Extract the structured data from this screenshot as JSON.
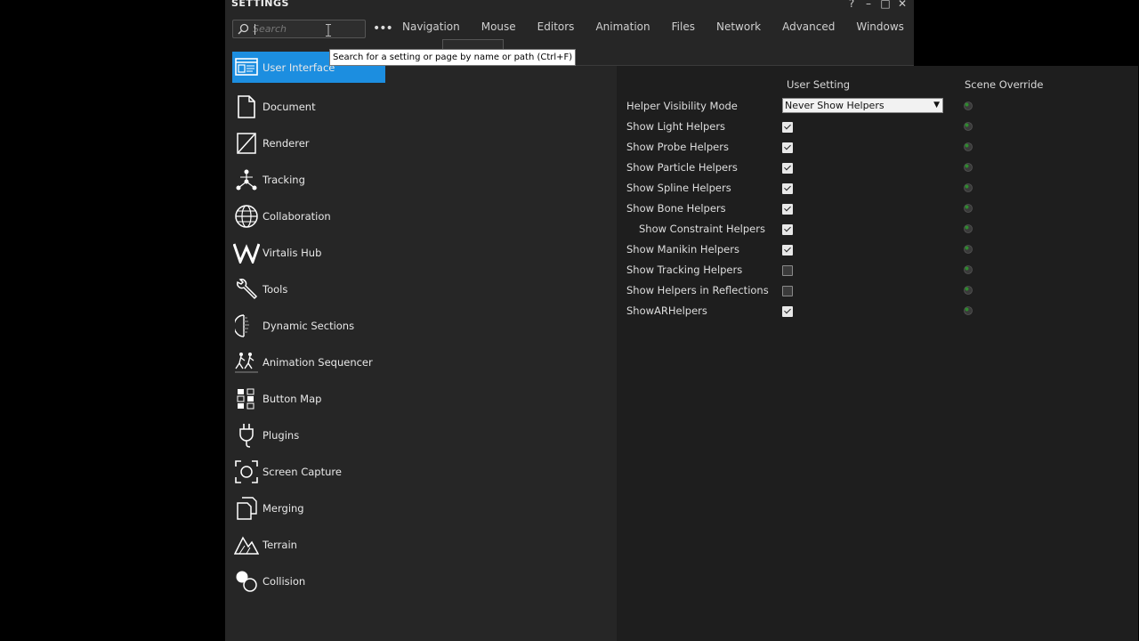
{
  "window": {
    "title": "SETTINGS",
    "controls": {
      "help": "?",
      "minimize": "–",
      "maximize": "□",
      "close": "✕"
    }
  },
  "search": {
    "placeholder": "Search",
    "value": ""
  },
  "more_button": "•••",
  "tabs": [
    {
      "label": "Navigation"
    },
    {
      "label": "Mouse"
    },
    {
      "label": "Editors"
    },
    {
      "label": "Animation"
    },
    {
      "label": "Files"
    },
    {
      "label": "Network"
    },
    {
      "label": "Advanced"
    },
    {
      "label": "Windows"
    }
  ],
  "tooltip": "Search for a setting or page by name or path (Ctrl+F)",
  "sidebar": {
    "items": [
      {
        "label": "User Interface",
        "icon": "user-interface-icon",
        "active": true
      },
      {
        "label": "Document",
        "icon": "document-icon"
      },
      {
        "label": "Renderer",
        "icon": "renderer-icon"
      },
      {
        "label": "Tracking",
        "icon": "tracking-icon"
      },
      {
        "label": "Collaboration",
        "icon": "globe-icon"
      },
      {
        "label": "Virtalis Hub",
        "icon": "virtalis-logo-icon"
      },
      {
        "label": "Tools",
        "icon": "wrench-icon"
      },
      {
        "label": "Dynamic Sections",
        "icon": "dynamic-sections-icon"
      },
      {
        "label": "Animation Sequencer",
        "icon": "animation-sequencer-icon"
      },
      {
        "label": "Button Map",
        "icon": "button-map-icon"
      },
      {
        "label": "Plugins",
        "icon": "plug-icon"
      },
      {
        "label": "Screen Capture",
        "icon": "screen-capture-icon"
      },
      {
        "label": "Merging",
        "icon": "merging-icon"
      },
      {
        "label": "Terrain",
        "icon": "terrain-icon"
      },
      {
        "label": "Collision",
        "icon": "collision-icon"
      }
    ]
  },
  "main": {
    "columns": {
      "user_setting": "User Setting",
      "scene_override": "Scene Override"
    },
    "helper_visibility": {
      "label": "Helper Visibility Mode",
      "value": "Never Show Helpers"
    },
    "rows": [
      {
        "label": "Show Light Helpers",
        "checked": true,
        "indent": false
      },
      {
        "label": "Show Probe Helpers",
        "checked": true,
        "indent": false
      },
      {
        "label": "Show Particle Helpers",
        "checked": true,
        "indent": false
      },
      {
        "label": "Show Spline Helpers",
        "checked": true,
        "indent": false
      },
      {
        "label": "Show Bone Helpers",
        "checked": true,
        "indent": false
      },
      {
        "label": "Show Constraint Helpers",
        "checked": true,
        "indent": true
      },
      {
        "label": "Show Manikin Helpers",
        "checked": true,
        "indent": false
      },
      {
        "label": "Show Tracking Helpers",
        "checked": false,
        "indent": false
      },
      {
        "label": "Show Helpers in Reflections",
        "checked": false,
        "indent": false
      },
      {
        "label": "ShowARHelpers",
        "checked": true,
        "indent": false
      }
    ]
  },
  "colors": {
    "accent": "#1c8ee0",
    "panel": "#262626",
    "content": "#1e1e1e",
    "override_dot": "#2f8a2f"
  }
}
